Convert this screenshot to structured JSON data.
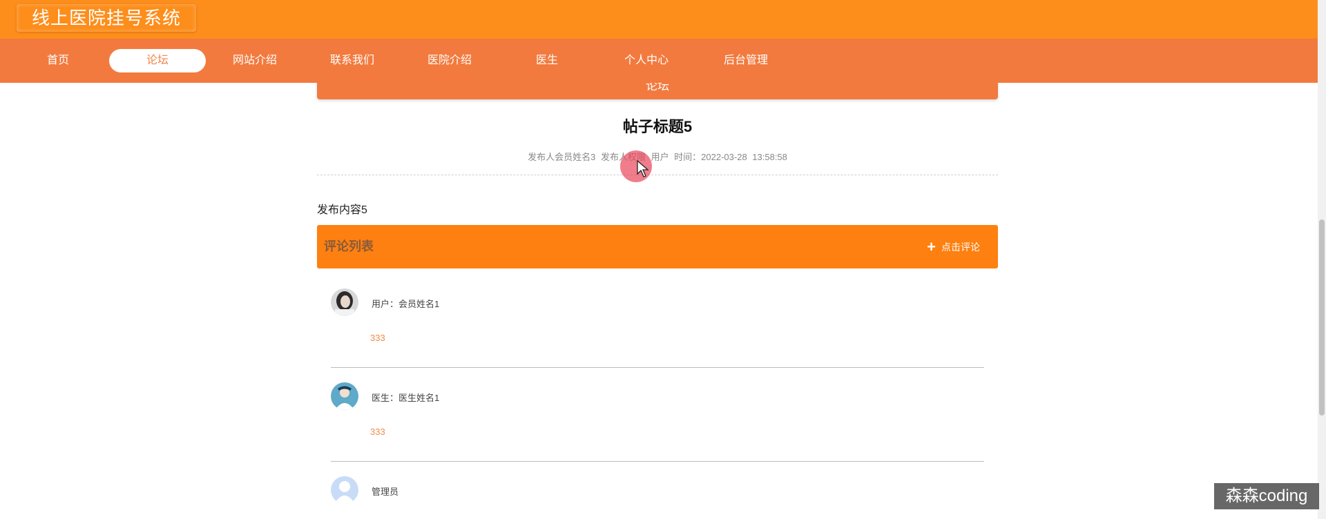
{
  "header": {
    "site_title": "线上医院挂号系统"
  },
  "nav": {
    "items": [
      {
        "label": "首页"
      },
      {
        "label": "论坛",
        "active": true
      },
      {
        "label": "网站介绍"
      },
      {
        "label": "联系我们"
      },
      {
        "label": "医院介绍"
      },
      {
        "label": "医生"
      },
      {
        "label": "个人中心"
      },
      {
        "label": "后台管理"
      }
    ]
  },
  "section": {
    "banner": "论坛"
  },
  "post": {
    "title": "帖子标题5",
    "meta": "发布人会员姓名3 发布人权限 用户 时间：2022-03-28 13:58:58",
    "content": "发布内容5"
  },
  "comments": {
    "header": "评论列表",
    "add_button": "点击评论",
    "items": [
      {
        "user": "用户：会员姓名1",
        "text": "333",
        "avatar": "woman-avatar-icon"
      },
      {
        "user": "医生：医生姓名1",
        "text": "333",
        "avatar": "doctor-avatar-icon"
      },
      {
        "user": "管理员",
        "text": "",
        "avatar": "default-user-avatar-icon"
      }
    ]
  },
  "watermark": "森森coding",
  "colors": {
    "topbar": "#fd8e1c",
    "navbar": "#f27a3e",
    "comments_header": "#fd8010",
    "comment_text": "#f28a4a"
  }
}
